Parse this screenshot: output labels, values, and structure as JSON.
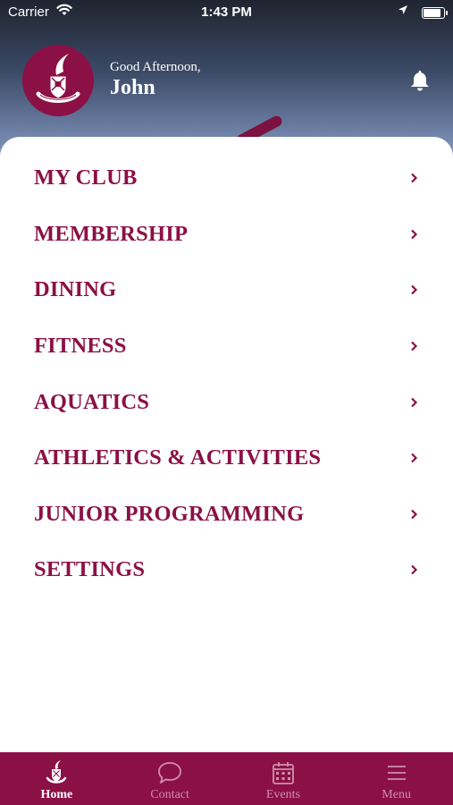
{
  "status_bar": {
    "carrier": "Carrier",
    "time": "1:43 PM",
    "battery_level": 0.95
  },
  "header": {
    "greeting": "Good Afternoon,",
    "user_name": "John"
  },
  "menu": {
    "items": [
      {
        "label": "MY CLUB"
      },
      {
        "label": "MEMBERSHIP"
      },
      {
        "label": "DINING"
      },
      {
        "label": "FITNESS"
      },
      {
        "label": "AQUATICS"
      },
      {
        "label": "ATHLETICS & ACTIVITIES"
      },
      {
        "label": "JUNIOR PROGRAMMING"
      },
      {
        "label": "SETTINGS"
      }
    ]
  },
  "tabbar": {
    "active": "Home",
    "tabs": [
      {
        "label": "Home",
        "icon": "crest-icon"
      },
      {
        "label": "Contact",
        "icon": "chat-bubble-icon"
      },
      {
        "label": "Events",
        "icon": "calendar-icon"
      },
      {
        "label": "Menu",
        "icon": "hamburger-icon"
      }
    ]
  },
  "colors": {
    "brand": "#8b1046",
    "tab_inactive": "#cf8fad",
    "text_light": "#ffffff"
  }
}
